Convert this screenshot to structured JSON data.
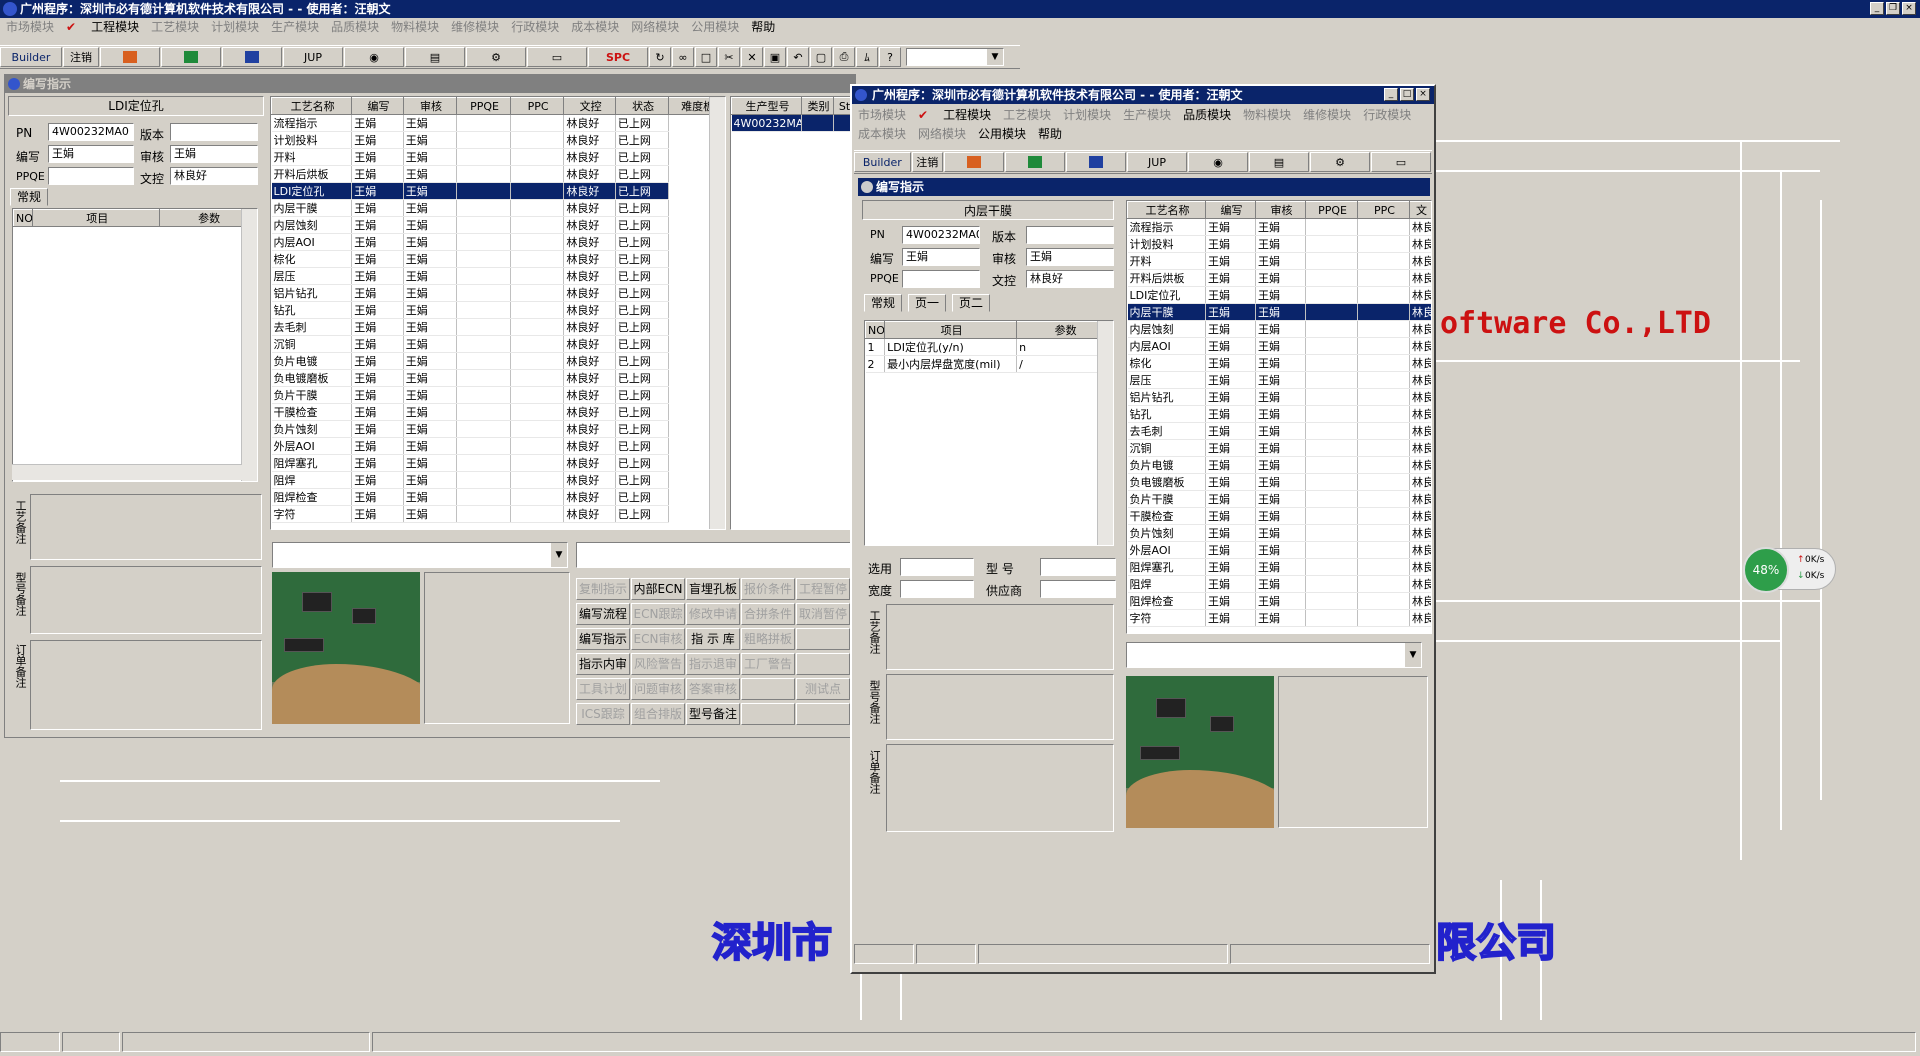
{
  "main_window": {
    "title": "广州程序：深圳市必有德计算机软件技术有限公司 - - 使用者：汪朝文",
    "menu": [
      "市场模块",
      "工程模块",
      "工艺模块",
      "计划模块",
      "生产模块",
      "品质模块",
      "物料模块",
      "维修模块",
      "行政模块",
      "成本模块",
      "网络模块",
      "公用模块",
      "帮助"
    ],
    "enabled_menu": [
      "工程模块",
      "帮助"
    ],
    "toolbar": {
      "builder": "Builder",
      "logout": "注销",
      "jup": "JUP",
      "spc": "SPC"
    }
  },
  "left_window": {
    "title": "编写指示",
    "step_title": "LDI定位孔",
    "fields": {
      "pn_label": "PN",
      "pn_value": "4W00232MA0",
      "version_label": "版本",
      "version_value": "",
      "writer_label": "编写",
      "writer_value": "王娟",
      "reviewer_label": "审核",
      "reviewer_value": "王娟",
      "ppqe_label": "PPQE",
      "ppqe_value": "",
      "doc_label": "文控",
      "doc_value": "林良好"
    },
    "tab_general": "常规",
    "param_headers": [
      "NO",
      "项目",
      "参数"
    ],
    "side_labels": [
      "工艺备注",
      "型号备注",
      "订单备注"
    ],
    "process_headers": [
      "工艺名称",
      "编写",
      "审核",
      "PPQE",
      "PPC",
      "文控",
      "状态",
      "难度板"
    ],
    "process_rows": [
      [
        "流程指示",
        "王娟",
        "王娟",
        "",
        "",
        "林良好",
        "已上网"
      ],
      [
        "计划投料",
        "王娟",
        "王娟",
        "",
        "",
        "林良好",
        "已上网"
      ],
      [
        "开料",
        "王娟",
        "王娟",
        "",
        "",
        "林良好",
        "已上网"
      ],
      [
        "开料后烘板",
        "王娟",
        "王娟",
        "",
        "",
        "林良好",
        "已上网"
      ],
      [
        "LDI定位孔",
        "王娟",
        "王娟",
        "",
        "",
        "林良好",
        "已上网"
      ],
      [
        "内层干膜",
        "王娟",
        "王娟",
        "",
        "",
        "林良好",
        "已上网"
      ],
      [
        "内层蚀刻",
        "王娟",
        "王娟",
        "",
        "",
        "林良好",
        "已上网"
      ],
      [
        "内层AOI",
        "王娟",
        "王娟",
        "",
        "",
        "林良好",
        "已上网"
      ],
      [
        "棕化",
        "王娟",
        "王娟",
        "",
        "",
        "林良好",
        "已上网"
      ],
      [
        "层压",
        "王娟",
        "王娟",
        "",
        "",
        "林良好",
        "已上网"
      ],
      [
        "铝片钻孔",
        "王娟",
        "王娟",
        "",
        "",
        "林良好",
        "已上网"
      ],
      [
        "钻孔",
        "王娟",
        "王娟",
        "",
        "",
        "林良好",
        "已上网"
      ],
      [
        "去毛刺",
        "王娟",
        "王娟",
        "",
        "",
        "林良好",
        "已上网"
      ],
      [
        "沉铜",
        "王娟",
        "王娟",
        "",
        "",
        "林良好",
        "已上网"
      ],
      [
        "负片电镀",
        "王娟",
        "王娟",
        "",
        "",
        "林良好",
        "已上网"
      ],
      [
        "负电镀磨板",
        "王娟",
        "王娟",
        "",
        "",
        "林良好",
        "已上网"
      ],
      [
        "负片干膜",
        "王娟",
        "王娟",
        "",
        "",
        "林良好",
        "已上网"
      ],
      [
        "干膜检查",
        "王娟",
        "王娟",
        "",
        "",
        "林良好",
        "已上网"
      ],
      [
        "负片蚀刻",
        "王娟",
        "王娟",
        "",
        "",
        "林良好",
        "已上网"
      ],
      [
        "外层AOI",
        "王娟",
        "王娟",
        "",
        "",
        "林良好",
        "已上网"
      ],
      [
        "阻焊塞孔",
        "王娟",
        "王娟",
        "",
        "",
        "林良好",
        "已上网"
      ],
      [
        "阻焊",
        "王娟",
        "王娟",
        "",
        "",
        "林良好",
        "已上网"
      ],
      [
        "阻焊检查",
        "王娟",
        "王娟",
        "",
        "",
        "林良好",
        "已上网"
      ],
      [
        "字符",
        "王娟",
        "王娟",
        "",
        "",
        "林良好",
        "已上网"
      ]
    ],
    "model_headers": [
      "生产型号",
      "类别",
      "St"
    ],
    "model_rows": [
      [
        "4W00232MA0",
        "",
        ""
      ]
    ],
    "buttons": [
      [
        "复制指示",
        "内部ECN",
        "盲埋孔板",
        "报价条件",
        "工程暂停"
      ],
      [
        "编写流程",
        "ECN跟踪",
        "修改申请",
        "合拼条件",
        "取消暂停"
      ],
      [
        "编写指示",
        "ECN审核",
        "指 示 库",
        "粗略拼板",
        ""
      ],
      [
        "指示内审",
        "风险警告",
        "指示退审",
        "工厂警告",
        ""
      ],
      [
        "工具计划",
        "问题审核",
        "答案审核",
        "",
        "测试点"
      ],
      [
        "ICS跟踪",
        "组合排版",
        "型号备注",
        "",
        ""
      ]
    ],
    "disabled_buttons": [
      "复制指示",
      "报价条件",
      "工程暂停",
      "ECN跟踪",
      "修改申请",
      "合拼条件",
      "取消暂停",
      "ECN审核",
      "粗略拼板",
      "风险警告",
      "指示退审",
      "工厂警告",
      "工具计划",
      "问题审核",
      "答案审核",
      "测试点",
      "ICS跟踪",
      "组合排版"
    ]
  },
  "right_window": {
    "title": "广州程序：深圳市必有德计算机软件技术有限公司 - - 使用者：汪朝文",
    "menu": [
      "市场模块",
      "工程模块",
      "工艺模块",
      "计划模块",
      "生产模块",
      "品质模块",
      "物料模块",
      "维修模块",
      "行政模块",
      "成本模块",
      "网络模块",
      "公用模块",
      "帮助"
    ],
    "enabled_menu": [
      "工程模块",
      "品质模块",
      "公用模块",
      "帮助"
    ],
    "toolbar": {
      "builder": "Builder",
      "logout": "注销",
      "jup": "JUP"
    },
    "sub_title": "编写指示",
    "step_title": "内层干膜",
    "fields": {
      "pn_label": "PN",
      "pn_value": "4W00232MA0",
      "version_label": "版本",
      "version_value": "",
      "writer_label": "编写",
      "writer_value": "王娟",
      "reviewer_label": "审核",
      "reviewer_value": "王娟",
      "ppqe_label": "PPQE",
      "ppqe_value": "",
      "doc_label": "文控",
      "doc_value": "林良好"
    },
    "tabs": [
      "常规",
      "页一",
      "页二"
    ],
    "param_headers": [
      "NO",
      "项目",
      "参数"
    ],
    "param_rows": [
      [
        "1",
        "LDI定位孔(y/n)",
        "n"
      ],
      [
        "2",
        "最小内层焊盘宽度(mil)",
        "/"
      ]
    ],
    "bottom_fields": {
      "select_label": "选用",
      "model_label": "型 号",
      "width_label": "宽度",
      "supplier_label": "供应商"
    },
    "side_labels": [
      "工艺备注",
      "型号备注",
      "订单备注"
    ],
    "process_headers": [
      "工艺名称",
      "编写",
      "审核",
      "PPQE",
      "PPC",
      "文"
    ],
    "process_rows": [
      [
        "流程指示",
        "王娟",
        "王娟",
        "",
        "",
        "林良"
      ],
      [
        "计划投料",
        "王娟",
        "王娟",
        "",
        "",
        "林良"
      ],
      [
        "开料",
        "王娟",
        "王娟",
        "",
        "",
        "林良"
      ],
      [
        "开料后烘板",
        "王娟",
        "王娟",
        "",
        "",
        "林良"
      ],
      [
        "LDI定位孔",
        "王娟",
        "王娟",
        "",
        "",
        "林良"
      ],
      [
        "内层干膜",
        "王娟",
        "王娟",
        "",
        "",
        "林良"
      ],
      [
        "内层蚀刻",
        "王娟",
        "王娟",
        "",
        "",
        "林良"
      ],
      [
        "内层AOI",
        "王娟",
        "王娟",
        "",
        "",
        "林良"
      ],
      [
        "棕化",
        "王娟",
        "王娟",
        "",
        "",
        "林良"
      ],
      [
        "层压",
        "王娟",
        "王娟",
        "",
        "",
        "林良"
      ],
      [
        "铝片钻孔",
        "王娟",
        "王娟",
        "",
        "",
        "林良"
      ],
      [
        "钻孔",
        "王娟",
        "王娟",
        "",
        "",
        "林良"
      ],
      [
        "去毛刺",
        "王娟",
        "王娟",
        "",
        "",
        "林良"
      ],
      [
        "沉铜",
        "王娟",
        "王娟",
        "",
        "",
        "林良"
      ],
      [
        "负片电镀",
        "王娟",
        "王娟",
        "",
        "",
        "林良"
      ],
      [
        "负电镀磨板",
        "王娟",
        "王娟",
        "",
        "",
        "林良"
      ],
      [
        "负片干膜",
        "王娟",
        "王娟",
        "",
        "",
        "林良"
      ],
      [
        "干膜检查",
        "王娟",
        "王娟",
        "",
        "",
        "林良"
      ],
      [
        "负片蚀刻",
        "王娟",
        "王娟",
        "",
        "",
        "林良"
      ],
      [
        "外层AOI",
        "王娟",
        "王娟",
        "",
        "",
        "林良"
      ],
      [
        "阻焊塞孔",
        "王娟",
        "王娟",
        "",
        "",
        "林良"
      ],
      [
        "阻焊",
        "王娟",
        "王娟",
        "",
        "",
        "林良"
      ],
      [
        "阻焊检查",
        "王娟",
        "王娟",
        "",
        "",
        "林良"
      ],
      [
        "字符",
        "王娟",
        "王娟",
        "",
        "",
        "林良"
      ]
    ]
  },
  "background": {
    "company_en": "oftware Co.,LTD",
    "company_cn_left": "深圳市",
    "company_cn_right": "限公司"
  },
  "net_widget": {
    "percent": "48%",
    "up": "0K/s",
    "down": "0K/s"
  },
  "colors": {
    "selection": "#0a246a",
    "desktop": "#d4d0c8",
    "brand_red": "#cc1111",
    "brand_blue": "#2222cc",
    "gauge_green": "#2e9e4a"
  }
}
